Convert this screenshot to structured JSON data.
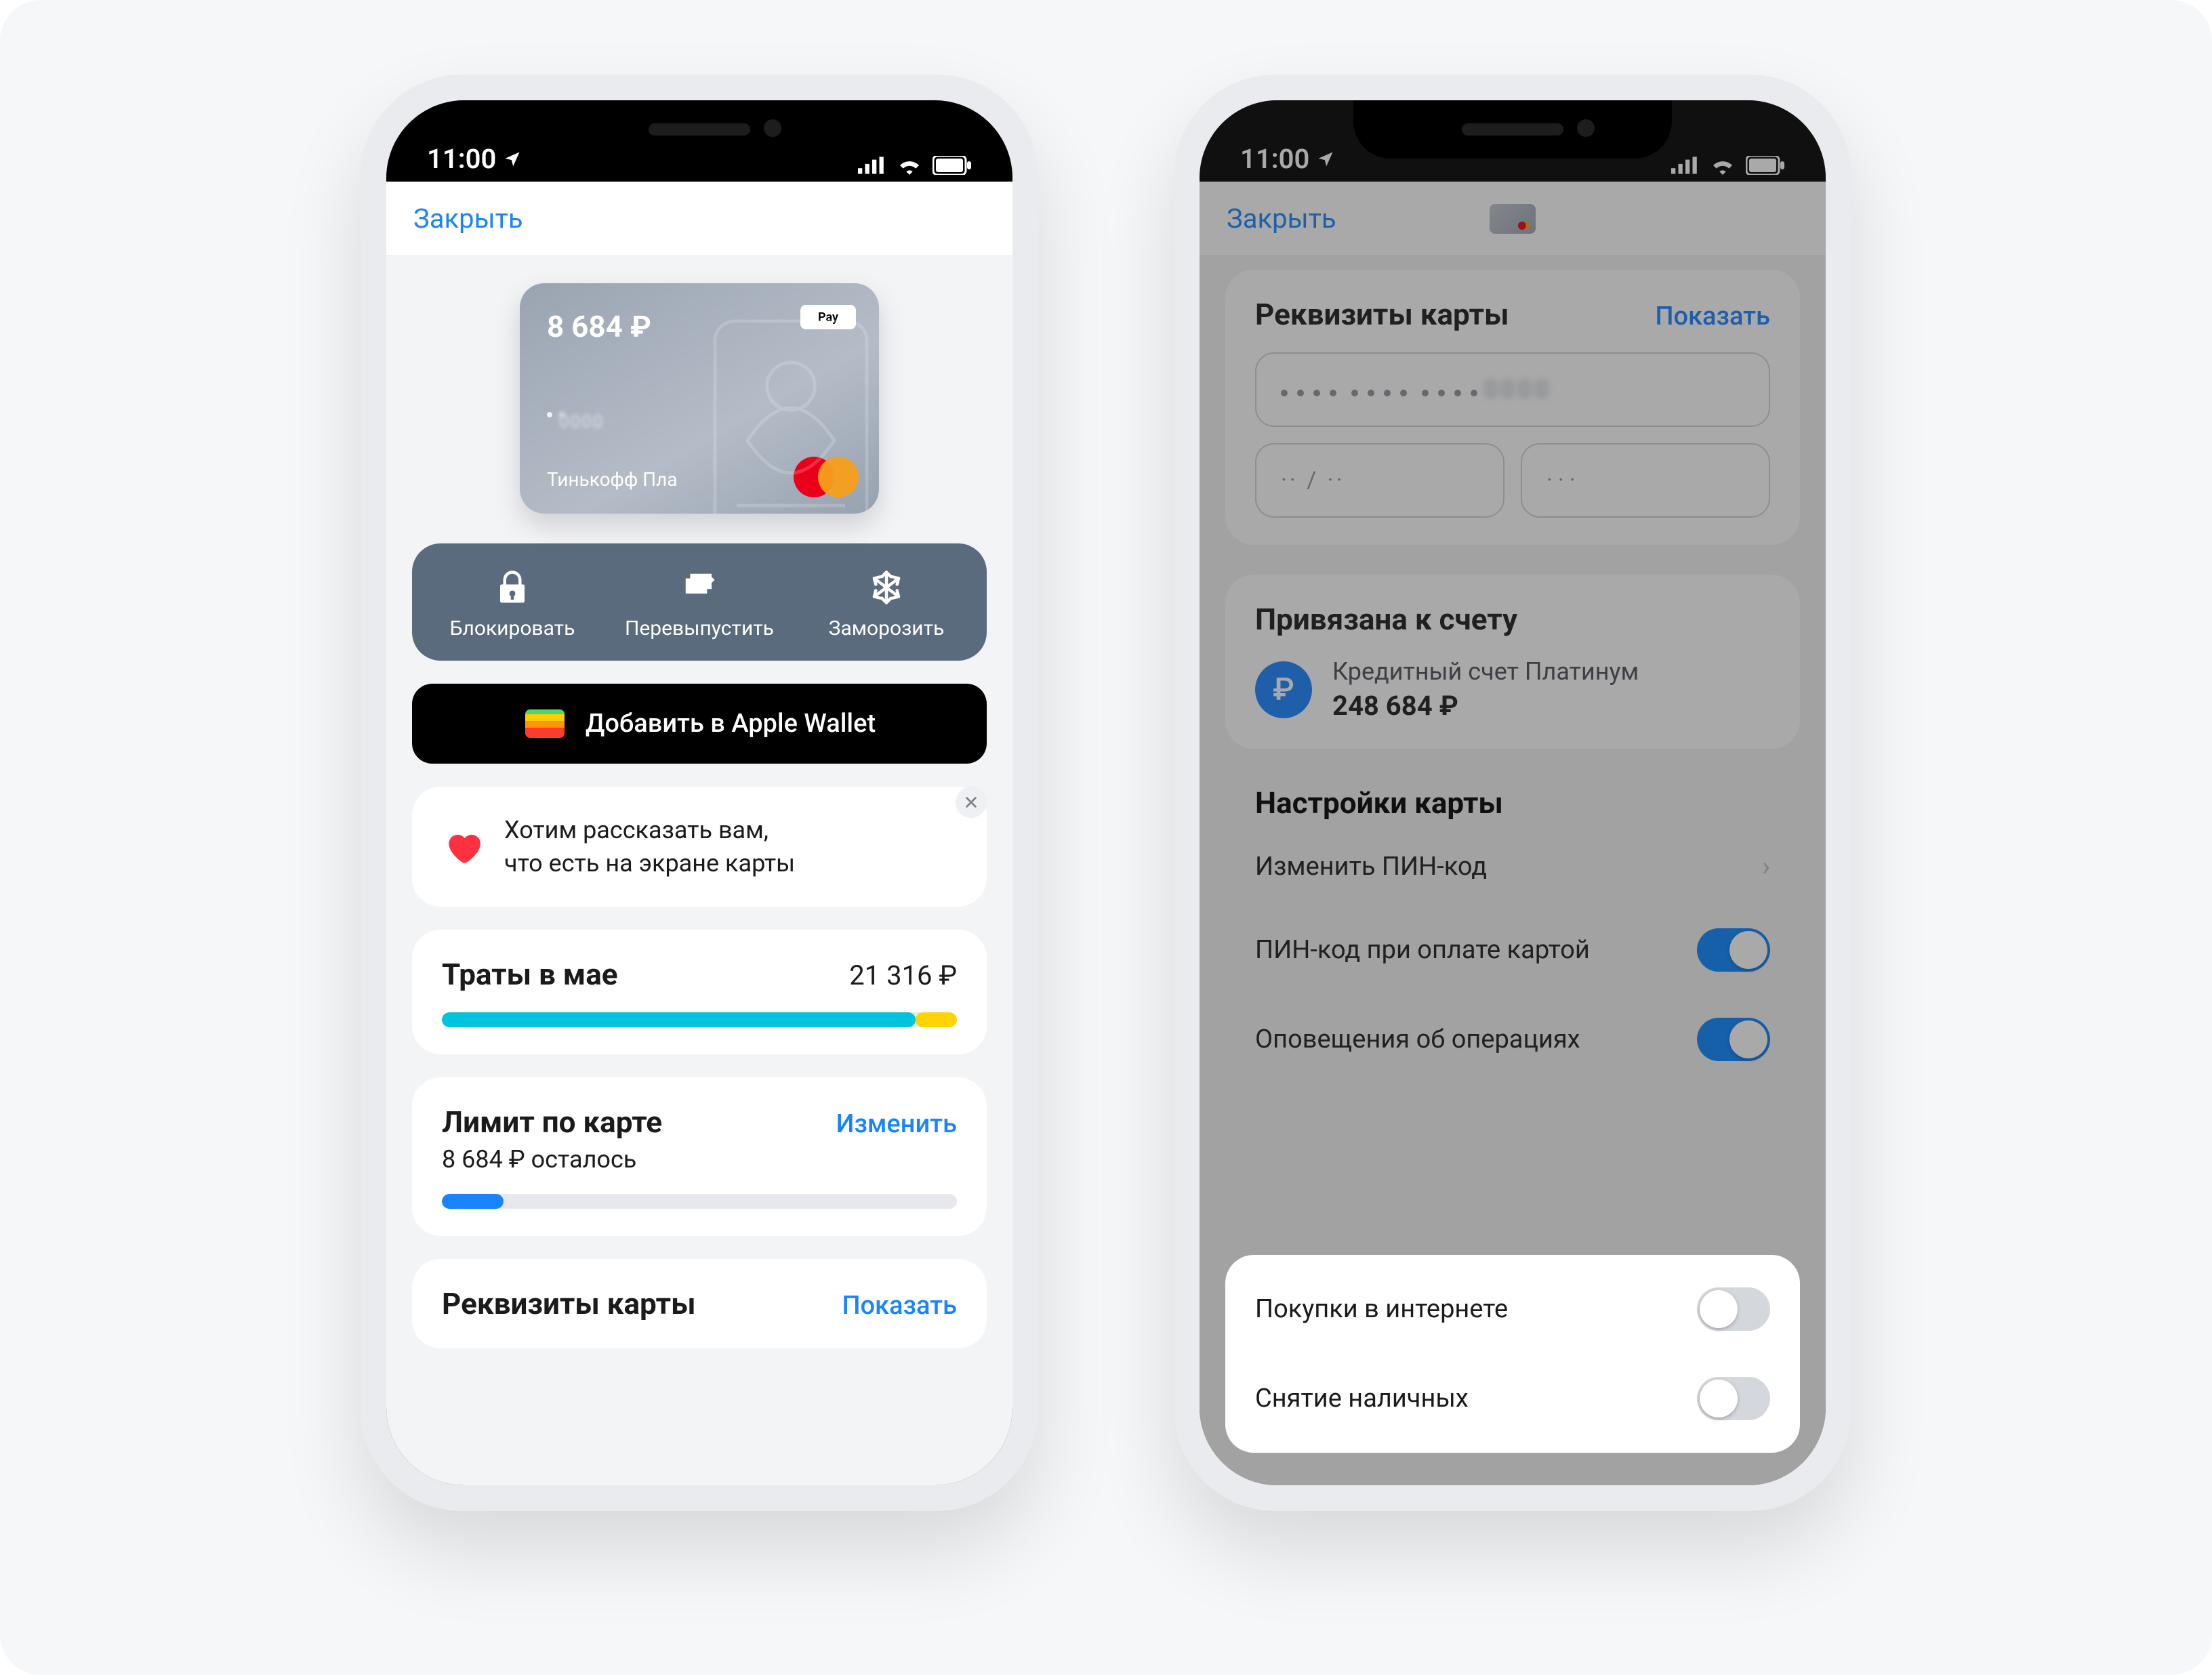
{
  "status": {
    "time": "11:00"
  },
  "nav": {
    "close": "Закрыть"
  },
  "card_visual": {
    "balance": "8 684 ₽",
    "apple_pay": "Pay",
    "name": "Тинькофф Пла"
  },
  "actions": {
    "block": "Блокировать",
    "reissue": "Перевыпустить",
    "freeze": "Заморозить"
  },
  "wallet_button": "Добавить в Apple Wallet",
  "banner": {
    "line1": "Хотим рассказать вам,",
    "line2": "что есть на экране карты"
  },
  "spend": {
    "title": "Траты в мае",
    "amount": "21 316 ₽"
  },
  "limit": {
    "title": "Лимит по карте",
    "action": "Изменить",
    "remaining": "8 684 ₽ осталось"
  },
  "requisites_peek": {
    "title": "Реквизиты карты",
    "action": "Показать"
  },
  "requisites": {
    "title": "Реквизиты карты",
    "action": "Показать",
    "pan": "···· ···· ····",
    "exp": "·· / ··",
    "cvc": "···"
  },
  "acct": {
    "title": "Привязана к счету",
    "symbol": "₽",
    "name": "Кредитный счет Платинум",
    "balance": "248 684 ₽"
  },
  "settings": {
    "title": "Настройки карты",
    "pin_change": "Изменить ПИН-код",
    "pin_pay": "ПИН-код при оплате картой",
    "notify": "Оповещения об операциях",
    "online": "Покупки в интернете",
    "cash": "Снятие наличных"
  }
}
